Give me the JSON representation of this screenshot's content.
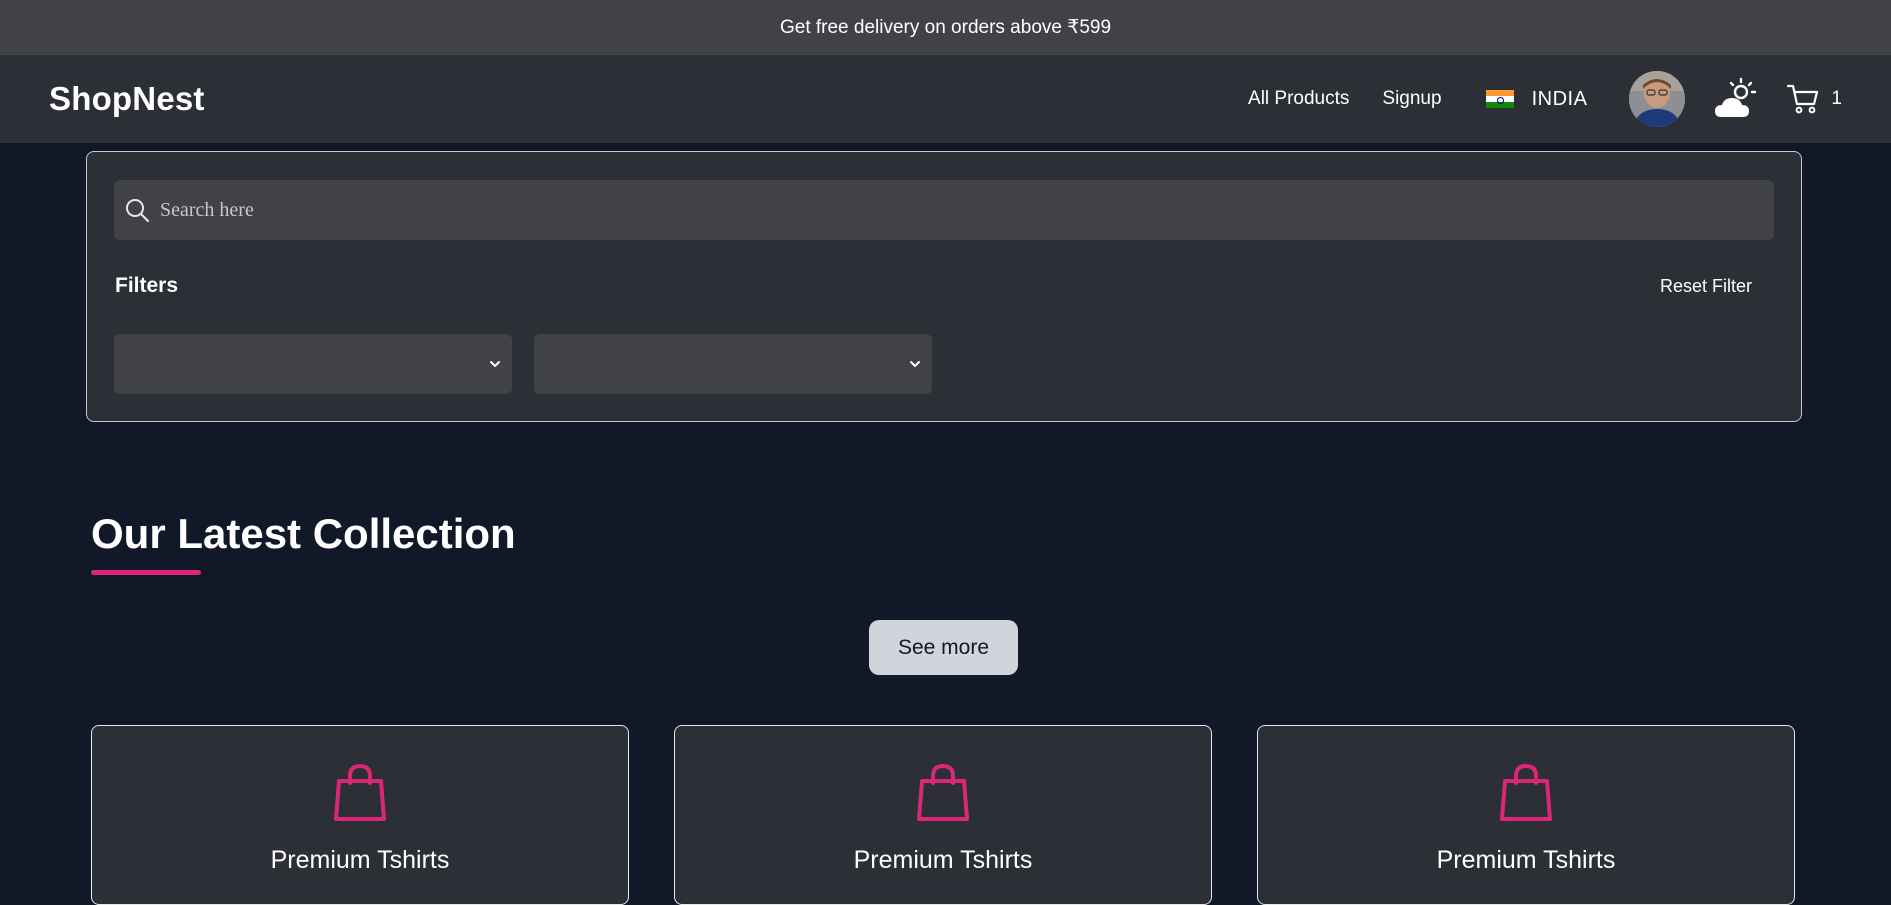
{
  "promo": {
    "text": "Get free delivery on orders above ₹599"
  },
  "navbar": {
    "brand": "ShopNest",
    "links": [
      "All Products",
      "Signup"
    ],
    "country": "INDIA",
    "cart_count": "1"
  },
  "search": {
    "placeholder": "Search here"
  },
  "filters": {
    "label": "Filters",
    "reset_label": "Reset Filter",
    "select_a_value": "",
    "select_b_value": ""
  },
  "collection": {
    "title": "Our Latest Collection",
    "see_more_label": "See more",
    "cards": [
      {
        "title": "Premium Tshirts",
        "icon": "shopping-bag-icon"
      },
      {
        "title": "Premium Tshirts",
        "icon": "shopping-bag-icon"
      },
      {
        "title": "Premium Tshirts",
        "icon": "shopping-bag-icon"
      }
    ]
  },
  "colors": {
    "page_bg": "#111827",
    "promo_bg": "#414246",
    "nav_bg": "#2d2f37",
    "accent": "#db2777",
    "button_bg": "#d1d5db"
  }
}
